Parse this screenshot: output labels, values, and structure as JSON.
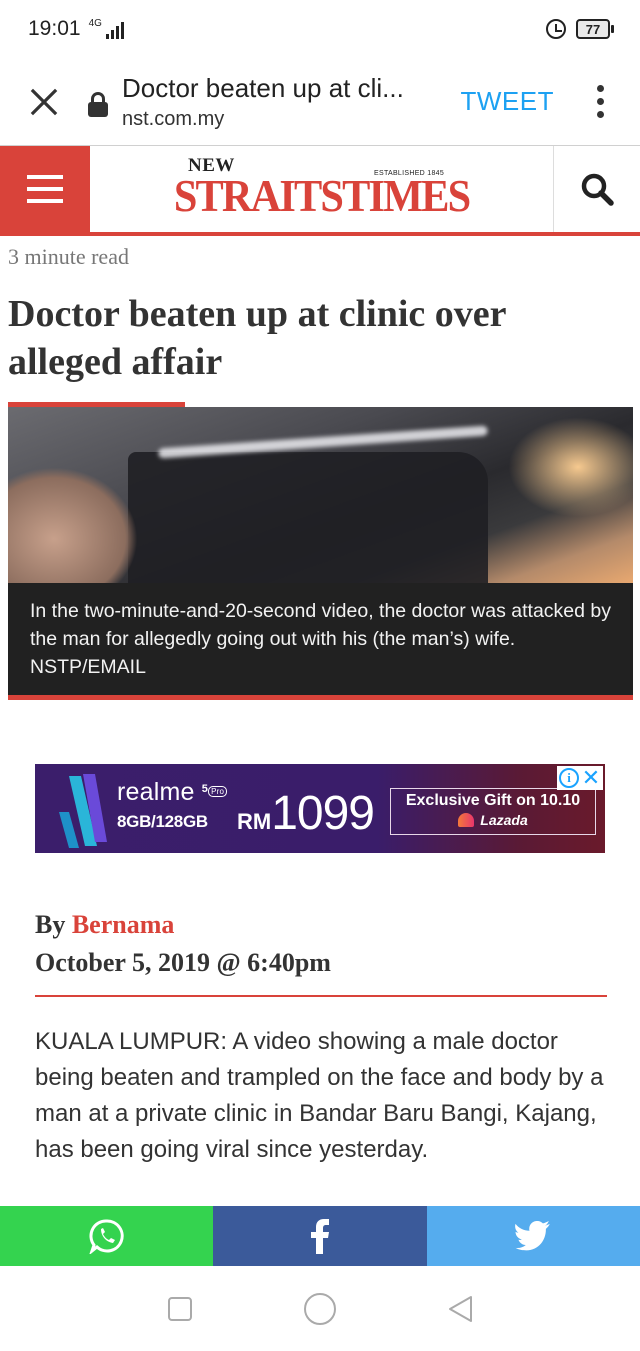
{
  "status_bar": {
    "time": "19:01",
    "network": "4G",
    "battery": "77"
  },
  "browser": {
    "page_title": "Doctor beaten up at cli...",
    "domain": "nst.com.my",
    "tweet_label": "TWEET"
  },
  "site": {
    "logo_new": "NEW",
    "logo_main": "STRAITSTIMES",
    "logo_established": "ESTABLISHED 1845",
    "accent_color": "#d9433a"
  },
  "article": {
    "read_time": "3 minute read",
    "headline": "Doctor beaten up at clinic over alleged affair",
    "image_caption": "In the two-minute-and-20-second video, the doctor was attacked by the man for allegedly going out with his (the man’s) wife. NSTP/EMAIL",
    "by_label": "By",
    "author": "Bernama",
    "date": "October 5, 2019 @ 6:40pm",
    "body": "KUALA LUMPUR: A video showing a male doctor being beaten and trampled on the face and body by a man at a private clinic in Bandar Baru Bangi, Kajang, has been going viral since yesterday."
  },
  "ad": {
    "brand": "realme",
    "model": "5",
    "storage": "8GB/128GB",
    "currency": "RM",
    "price": "1099",
    "promo": "Exclusive Gift on 10.10",
    "retailer": "Lazada"
  },
  "share": {
    "icons": [
      "whatsapp-icon",
      "facebook-icon",
      "twitter-icon"
    ],
    "colors": [
      "#34d34f",
      "#3b5a9a",
      "#55acee"
    ]
  },
  "nav": {
    "icons": [
      "recents-icon",
      "home-icon",
      "back-icon"
    ]
  }
}
